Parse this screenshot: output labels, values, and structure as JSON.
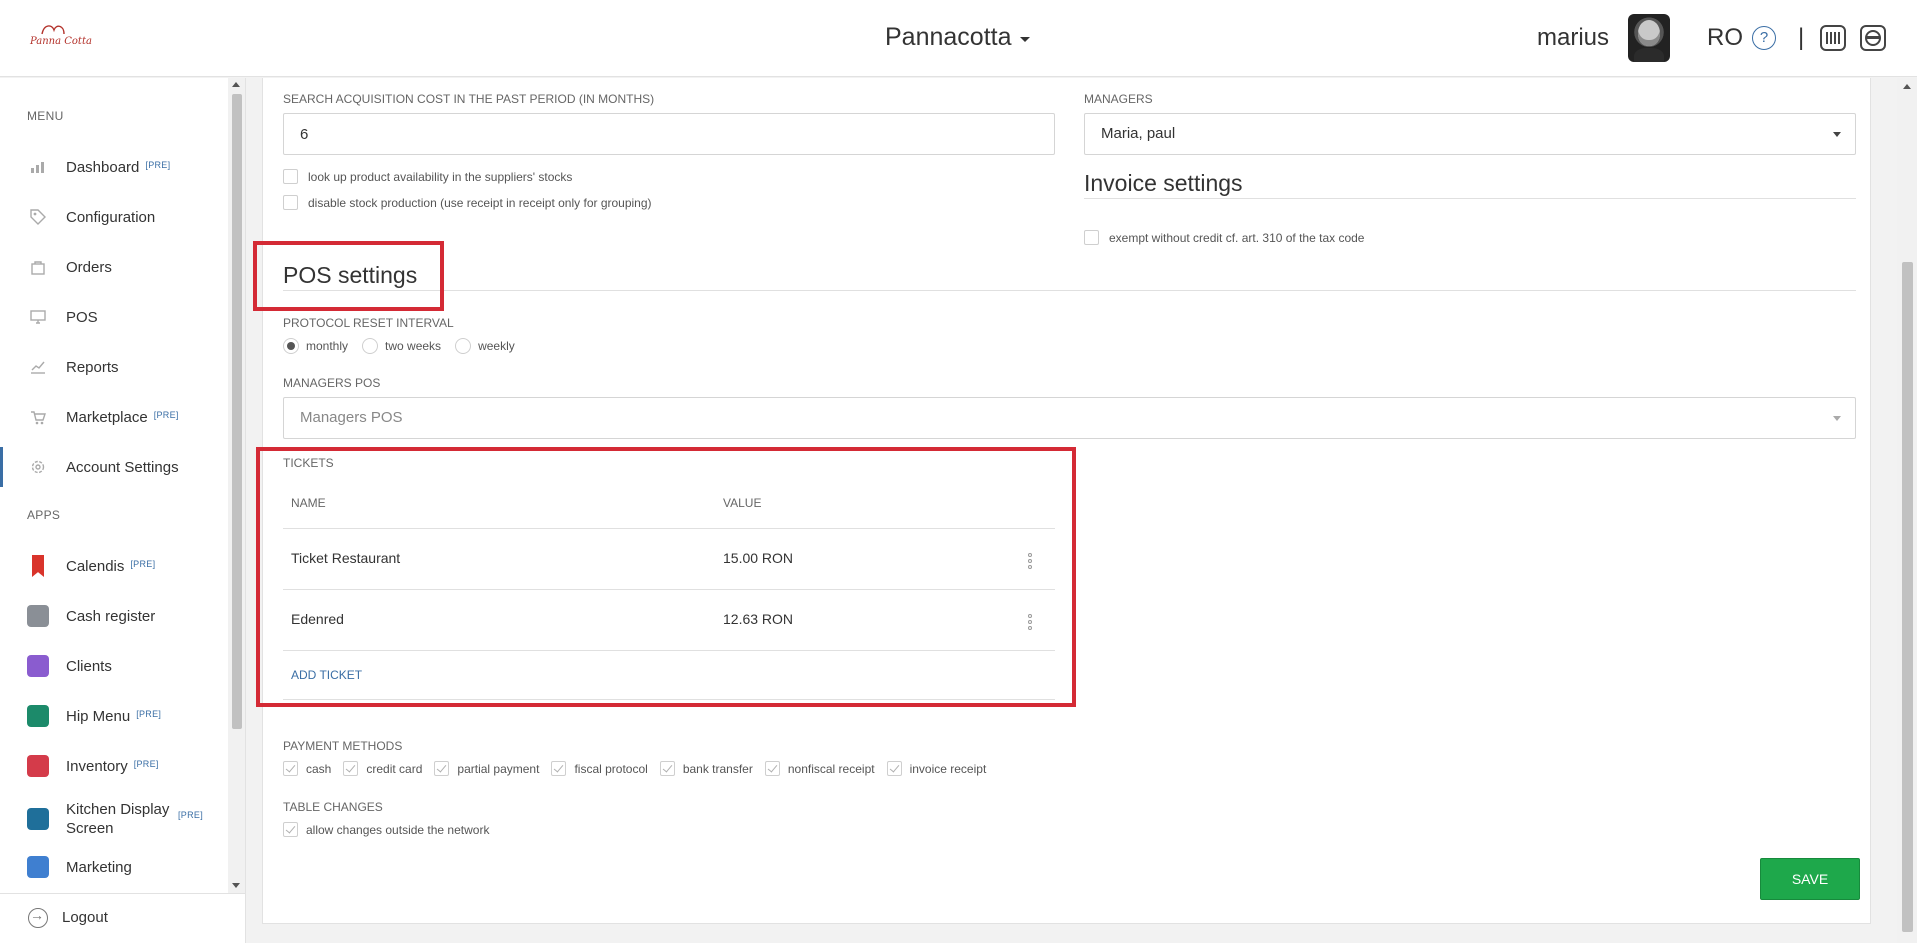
{
  "header": {
    "logo_text": "Panna Cotta",
    "brand": "Pannacotta",
    "user_name": "marius",
    "language": "RO",
    "help_icon": "?",
    "separator": "|"
  },
  "sidebar": {
    "menu_label": "MENU",
    "apps_label": "APPS",
    "menu_items": [
      {
        "label": "Dashboard",
        "pre": "[PRE]",
        "icon": "chart-icon"
      },
      {
        "label": "Configuration",
        "pre": "",
        "icon": "tag-icon"
      },
      {
        "label": "Orders",
        "pre": "",
        "icon": "bag-icon"
      },
      {
        "label": "POS",
        "pre": "",
        "icon": "monitor-icon"
      },
      {
        "label": "Reports",
        "pre": "",
        "icon": "line-chart-icon"
      },
      {
        "label": "Marketplace",
        "pre": "[PRE]",
        "icon": "cart-icon"
      },
      {
        "label": "Account Settings",
        "pre": "",
        "icon": "gear-icon"
      }
    ],
    "app_items": [
      {
        "label": "Calendis",
        "pre": "[PRE]",
        "color": "#d9342b"
      },
      {
        "label": "Cash register",
        "pre": "",
        "color": "#8a8f96"
      },
      {
        "label": "Clients",
        "pre": "",
        "color": "#8a5ccf"
      },
      {
        "label": "Hip Menu",
        "pre": "[PRE]",
        "color": "#1c8a6a"
      },
      {
        "label": "Inventory",
        "pre": "[PRE]",
        "color": "#d43b4a"
      },
      {
        "label": "Kitchen Display",
        "label2": "Screen",
        "pre": "[PRE]",
        "color": "#1f6f9a"
      },
      {
        "label": "Marketing",
        "pre": "",
        "color": "#3f7fd0"
      }
    ],
    "logout_label": "Logout"
  },
  "settings": {
    "acq_label": "SEARCH ACQUISITION COST IN THE PAST PERIOD (IN MONTHS)",
    "acq_value": "6",
    "check_availability": "look up product availability in the suppliers' stocks",
    "check_disable_stock": "disable stock production (use receipt in receipt only for grouping)",
    "managers_label": "MANAGERS",
    "managers_value": "Maria, paul",
    "invoice_title": "Invoice settings",
    "invoice_exempt": "exempt without credit cf. art. 310 of the tax code"
  },
  "pos": {
    "title": "POS settings",
    "reset_label": "PROTOCOL RESET INTERVAL",
    "reset_options": [
      "monthly",
      "two weeks",
      "weekly"
    ],
    "reset_selected": "monthly",
    "managers_pos_label": "MANAGERS POS",
    "managers_pos_placeholder": "Managers POS",
    "tickets_label": "TICKETS",
    "tickets_columns": [
      "NAME",
      "VALUE"
    ],
    "tickets": [
      {
        "name": "Ticket Restaurant",
        "value": "15.00 RON"
      },
      {
        "name": "Edenred",
        "value": "12.63 RON"
      }
    ],
    "add_ticket": "ADD TICKET",
    "payment_label": "PAYMENT METHODS",
    "payment_methods": [
      "cash",
      "credit card",
      "partial payment",
      "fiscal protocol",
      "bank transfer",
      "nonfiscal receipt",
      "invoice receipt"
    ],
    "table_changes_label": "TABLE CHANGES",
    "table_changes_option": "allow changes outside the network"
  },
  "actions": {
    "save": "SAVE"
  },
  "colors": {
    "accent": "#3a6ea5",
    "save": "#1ea84b",
    "highlight": "#d42a35"
  }
}
